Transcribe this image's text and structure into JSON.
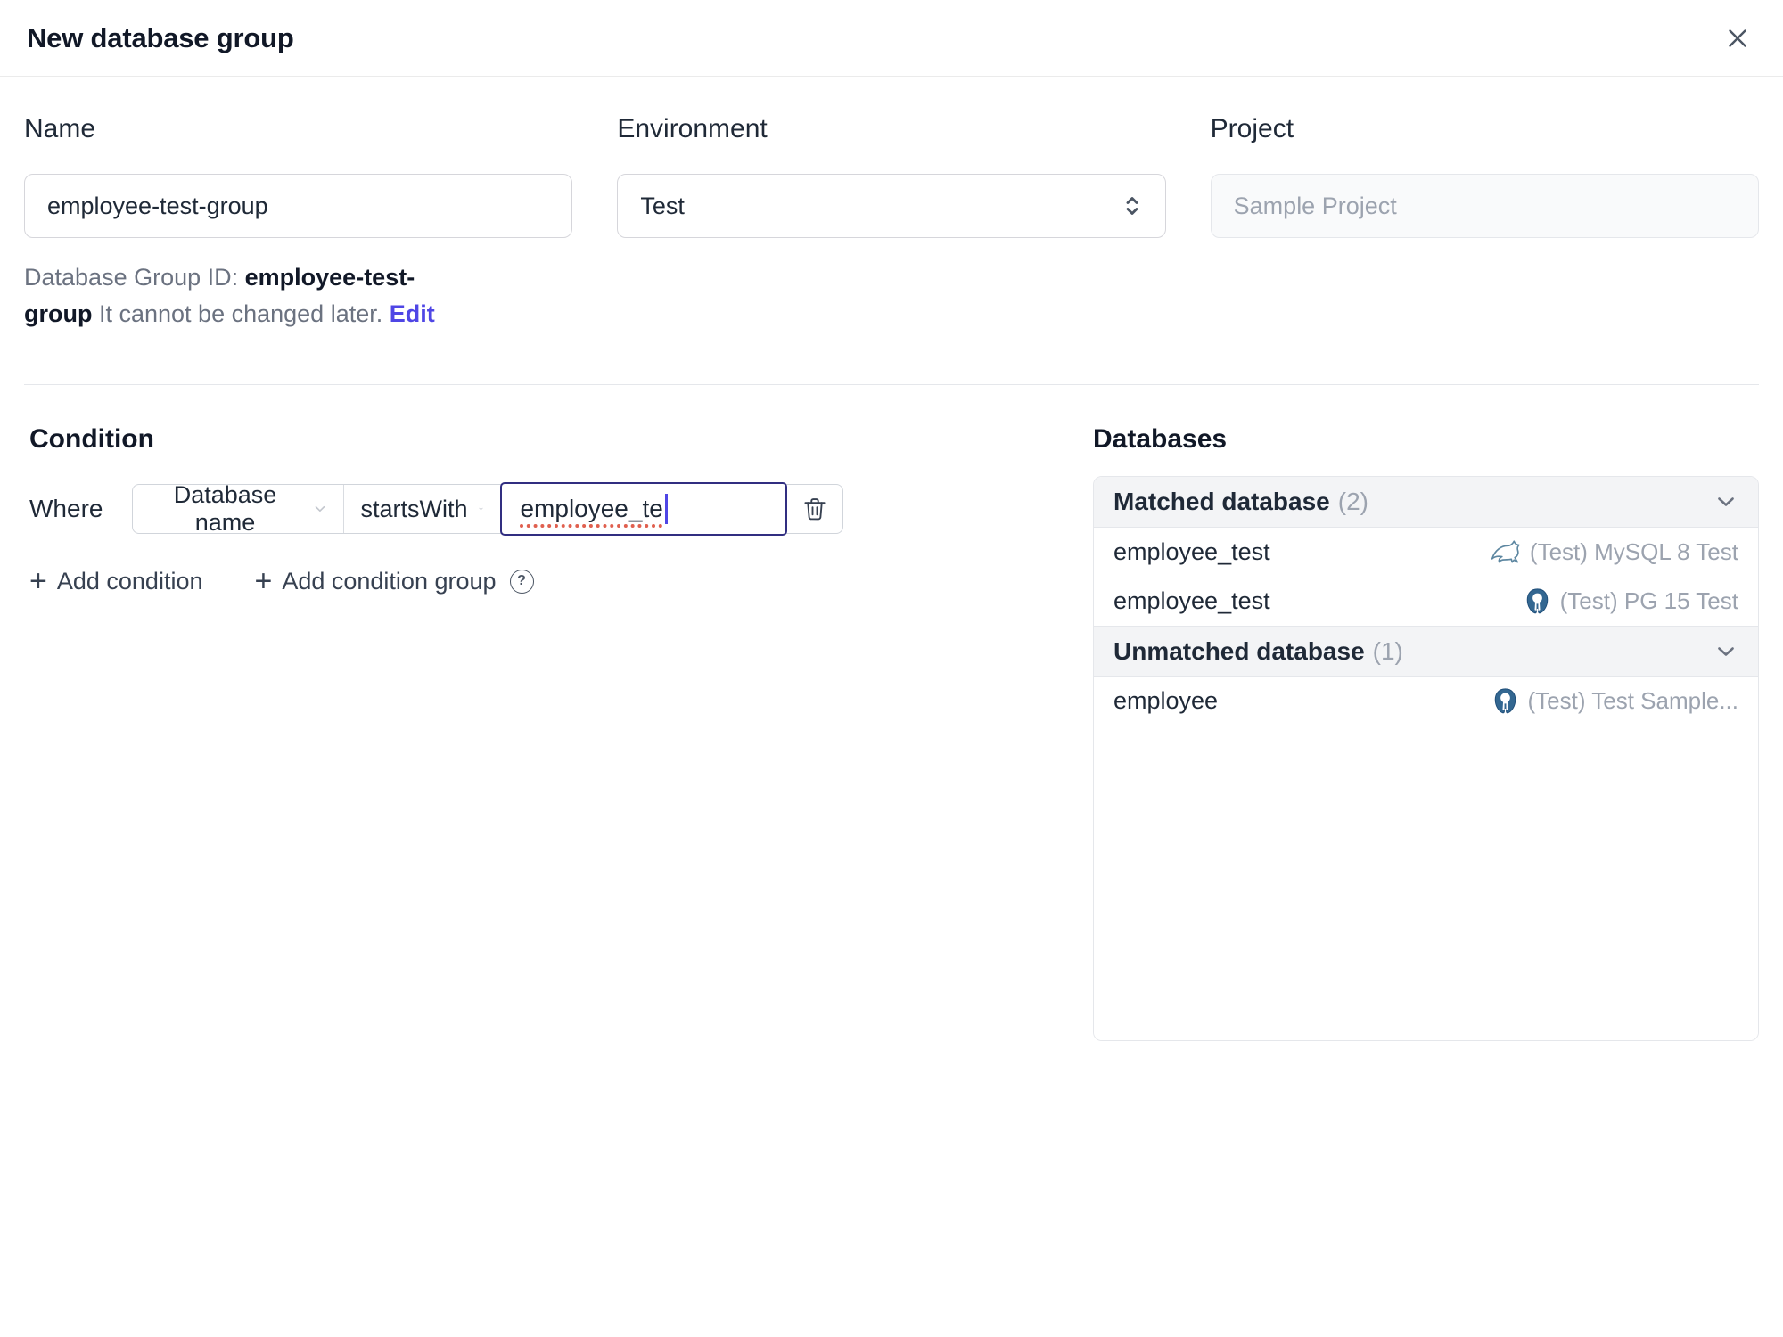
{
  "dialog": {
    "title": "New database group"
  },
  "icons": {
    "plus": "+",
    "help": "?"
  },
  "form": {
    "name": {
      "label": "Name",
      "value": "employee-test-group"
    },
    "environment": {
      "label": "Environment",
      "value": "Test"
    },
    "project": {
      "label": "Project",
      "value": "Sample Project"
    },
    "id_hint": {
      "prefix": "Database Group ID: ",
      "id": "employee-test-group",
      "suffix": " It cannot be changed later. ",
      "edit_label": "Edit"
    }
  },
  "condition": {
    "heading": "Condition",
    "where_label": "Where",
    "field": "Database name",
    "operator": "startsWith",
    "value": "employee_te",
    "add_condition_label": "Add condition",
    "add_condition_group_label": "Add condition group"
  },
  "databases": {
    "heading": "Databases",
    "matched": {
      "title": "Matched database",
      "count": "(2)"
    },
    "unmatched": {
      "title": "Unmatched database",
      "count": "(1)"
    },
    "rows": [
      {
        "name": "employee_test",
        "instance": "(Test) MySQL 8 Test",
        "engine": "mysql"
      },
      {
        "name": "employee_test",
        "instance": "(Test) PG 15 Test",
        "engine": "postgres"
      },
      {
        "name": "employee",
        "instance": "(Test) Test Sample...",
        "engine": "postgres"
      }
    ]
  },
  "colors": {
    "accent": "#4f46e5",
    "focus_border": "#312e81",
    "mysql_icon": "#5d87a1",
    "postgres_icon": "#336791"
  }
}
